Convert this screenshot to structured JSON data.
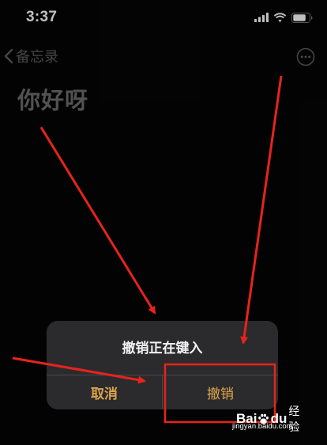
{
  "status_bar": {
    "time": "3:37",
    "icons": [
      "cellular-signal-icon",
      "wifi-icon",
      "battery-icon"
    ]
  },
  "nav": {
    "back_label": "备忘录",
    "more_icon": "ellipsis-circle-icon"
  },
  "note": {
    "title": "你好呀"
  },
  "alert": {
    "message": "撤销正在键入",
    "cancel_label": "取消",
    "undo_label": "撤销"
  },
  "watermark": {
    "brand_left": "Bai",
    "brand_right": "du",
    "brand_suffix": "经验",
    "url": "jingyan.baidu.com"
  },
  "colors": {
    "background": "#050505",
    "alert_background": "#2b2b2d",
    "alert_button_text": "#d9a44b",
    "annotation_red": "#e8231b",
    "nav_gray": "#5e5e5e"
  }
}
